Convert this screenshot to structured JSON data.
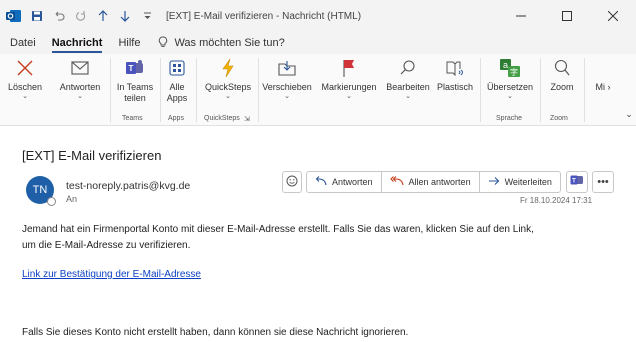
{
  "titlebar": {
    "app_icon": "outlook-icon",
    "title": "[EXT] E-Mail verifizieren  -  Nachricht (HTML)",
    "quick_access": [
      "save-icon",
      "undo-icon",
      "redo-icon",
      "up-icon",
      "down-icon",
      "customize-icon"
    ],
    "window_controls": [
      "minimize-icon",
      "maximize-icon",
      "close-icon"
    ]
  },
  "menu": {
    "items": [
      "Datei",
      "Nachricht",
      "Hilfe"
    ],
    "active": "Nachricht",
    "search_placeholder": "Was möchten Sie tun?"
  },
  "ribbon": {
    "buttons": {
      "delete": "Löschen",
      "reply": "Antworten",
      "teams_line1": "In Teams",
      "teams_line2": "teilen",
      "apps_line1": "Alle",
      "apps_line2": "Apps",
      "quicksteps": "QuickSteps",
      "move": "Verschieben",
      "tags": "Markierungen",
      "edit": "Bearbeiten",
      "immersive": "Plastisch",
      "translate": "Übersetzen",
      "zoom": "Zoom",
      "more": "Mi"
    },
    "groups": {
      "teams": "Teams",
      "apps": "Apps",
      "quicksteps": "QuickSteps",
      "language": "Sprache",
      "zoom": "Zoom"
    }
  },
  "message": {
    "subject": "[EXT] E-Mail verifizieren",
    "avatar_initials": "TN",
    "sender": "test-noreply.patris@kvg.de",
    "to_label": "An",
    "date": "Fr 18.10.2024 17:31",
    "actions": {
      "reply": "Antworten",
      "reply_all": "Allen antworten",
      "forward": "Weiterleiten"
    },
    "body_line1": "Jemand hat ein Firmenportal Konto mit dieser E-Mail-Adresse erstellt. Falls Sie das waren, klicken Sie auf den Link,",
    "body_line2": "um die E-Mail-Adresse zu verifizieren.",
    "link_text": "Link zur Bestätigung der E-Mail-Adresse",
    "footer": "Falls Sie dieses Konto nicht erstellt haben, dann können sie diese Nachricht ignorieren."
  },
  "colors": {
    "accent": "#2b579a",
    "avatar": "#1f5fa8",
    "link": "#0b3fc4",
    "delete": "#c43e1c",
    "flag": "#d13438"
  }
}
